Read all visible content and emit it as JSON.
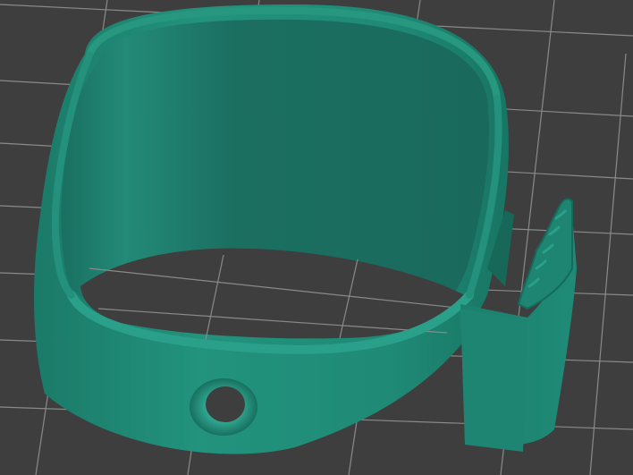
{
  "viewport": {
    "background_color": "#3e3e3e",
    "grid_line_color": "#8a8a8a"
  },
  "model": {
    "body_color": "#1f8a76",
    "body_shadow_color": "#15695a",
    "interior_color": "#1a6e5f",
    "rim_highlight_color": "#2aa08a",
    "features": [
      "band",
      "clip",
      "mounting-hole"
    ]
  }
}
